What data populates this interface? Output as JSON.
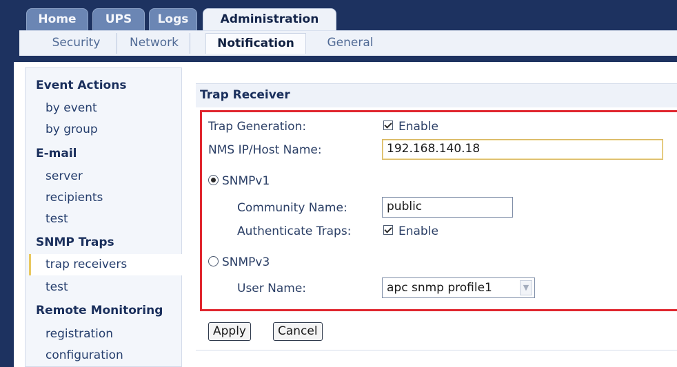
{
  "main_tabs": [
    {
      "label": "Home",
      "active": false
    },
    {
      "label": "UPS",
      "active": false
    },
    {
      "label": "Logs",
      "active": false
    },
    {
      "label": "Administration",
      "active": true
    }
  ],
  "sub_tabs": [
    {
      "label": "Security",
      "active": false
    },
    {
      "label": "Network",
      "active": false
    },
    {
      "label": "Notification",
      "active": true
    },
    {
      "label": "General",
      "active": false
    }
  ],
  "sidebar": {
    "sections": [
      {
        "title": "Event Actions",
        "items": [
          "by event",
          "by group"
        ]
      },
      {
        "title": "E-mail",
        "items": [
          "server",
          "recipients",
          "test"
        ]
      },
      {
        "title": "SNMP Traps",
        "items": [
          "trap receivers",
          "test"
        ]
      },
      {
        "title": "Remote Monitoring",
        "items": [
          "registration",
          "configuration"
        ]
      }
    ],
    "selected": "trap receivers"
  },
  "trap_receiver": {
    "title": "Trap Receiver",
    "trap_generation_label": "Trap Generation:",
    "trap_generation_checked": true,
    "enable_label": "Enable",
    "nms_label": "NMS IP/Host Name:",
    "nms_value": "192.168.140.18",
    "snmpv1_label": "SNMPv1",
    "snmpv1_selected": true,
    "community_label": "Community Name:",
    "community_value": "public",
    "auth_label": "Authenticate Traps:",
    "auth_checked": true,
    "snmpv3_label": "SNMPv3",
    "snmpv3_selected": false,
    "user_label": "User Name:",
    "user_value": "apc snmp profile1"
  },
  "buttons": {
    "apply": "Apply",
    "cancel": "Cancel"
  },
  "colors": {
    "nav_navy": "#1d3260",
    "highlight_red": "#e0262e",
    "selected_accent": "#e9c860"
  }
}
